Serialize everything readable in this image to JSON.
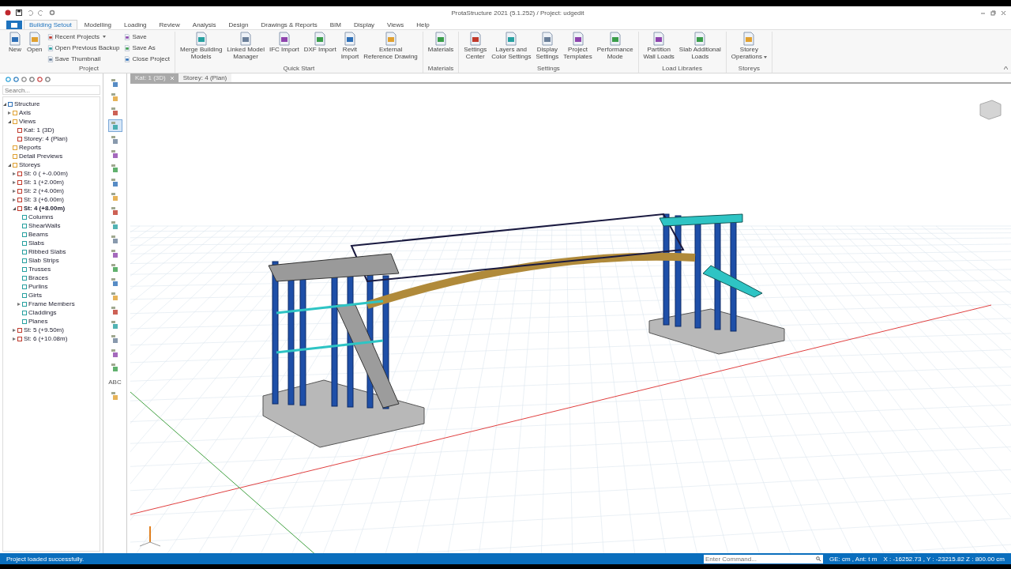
{
  "title_bar": {
    "title": "ProtaStructure 2021 (5.1.252) / Project: udgedit"
  },
  "menu_tabs": [
    {
      "label": "Building Setout",
      "selected": true
    },
    {
      "label": "Modelling",
      "selected": false
    },
    {
      "label": "Loading",
      "selected": false
    },
    {
      "label": "Review",
      "selected": false
    },
    {
      "label": "Analysis",
      "selected": false
    },
    {
      "label": "Design",
      "selected": false
    },
    {
      "label": "Drawings & Reports",
      "selected": false
    },
    {
      "label": "BIM",
      "selected": false
    },
    {
      "label": "Display",
      "selected": false
    },
    {
      "label": "Views",
      "selected": false
    },
    {
      "label": "Help",
      "selected": false
    }
  ],
  "ribbon_groups": [
    {
      "label": "Project",
      "buttons": [
        {
          "label": "New",
          "kind": "large"
        },
        {
          "label": "Open",
          "kind": "large"
        },
        {
          "label": "Recent Projects",
          "kind": "small",
          "dropdown": true
        },
        {
          "label": "Open Previous Backup",
          "kind": "small"
        },
        {
          "label": "Save Thumbnail",
          "kind": "small"
        },
        {
          "label": "Save",
          "kind": "small"
        },
        {
          "label": "Save As",
          "kind": "small"
        },
        {
          "label": "Close Project",
          "kind": "small"
        }
      ]
    },
    {
      "label": "Quick Start",
      "buttons": [
        {
          "label": "Merge Building\nModels",
          "kind": "large"
        },
        {
          "label": "Linked Model\nManager",
          "kind": "large"
        },
        {
          "label": "IFC Import",
          "kind": "large"
        },
        {
          "label": "DXF Import",
          "kind": "large"
        },
        {
          "label": "Revit\nImport",
          "kind": "large"
        },
        {
          "label": "External\nReference Drawing",
          "kind": "large"
        }
      ]
    },
    {
      "label": "Materials",
      "buttons": [
        {
          "label": "Materials",
          "kind": "large"
        }
      ]
    },
    {
      "label": "Settings",
      "buttons": [
        {
          "label": "Settings\nCenter",
          "kind": "large"
        },
        {
          "label": "Layers and\nColor Settings",
          "kind": "large"
        },
        {
          "label": "Display\nSettings",
          "kind": "large"
        },
        {
          "label": "Project\nTemplates",
          "kind": "large"
        },
        {
          "label": "Performance\nMode",
          "kind": "large"
        }
      ]
    },
    {
      "label": "Load Libraries",
      "buttons": [
        {
          "label": "Partition\nWall Loads",
          "kind": "large"
        },
        {
          "label": "Slab Additional\nLoads",
          "kind": "large"
        }
      ]
    },
    {
      "label": "Storeys",
      "buttons": [
        {
          "label": "Storey\nOperations",
          "kind": "large",
          "dropdown": true
        }
      ]
    }
  ],
  "explorer": {
    "search": {
      "placeholder": "Search..."
    },
    "tree": [
      {
        "label": "Structure",
        "expanded": true,
        "children": [
          {
            "label": "Axis",
            "expanded": false
          },
          {
            "label": "Views",
            "expanded": true,
            "children": [
              {
                "label": "Kat: 1 (3D)"
              },
              {
                "label": "Storey: 4 (Plan)"
              }
            ]
          },
          {
            "label": "Reports"
          },
          {
            "label": "Detail Previews"
          },
          {
            "label": "Storeys",
            "expanded": true,
            "children": [
              {
                "label": "St: 0 ( +-0.00m)",
                "expanded": false
              },
              {
                "label": "St: 1 (+2.00m)",
                "expanded": false
              },
              {
                "label": "St: 2 (+4.00m)",
                "expanded": false
              },
              {
                "label": "St: 3 (+6.00m)",
                "expanded": false
              },
              {
                "label": "St: 4 (+8.00m)",
                "expanded": true,
                "active": true,
                "children": [
                  {
                    "label": "Columns"
                  },
                  {
                    "label": "ShearWalls"
                  },
                  {
                    "label": "Beams"
                  },
                  {
                    "label": "Slabs"
                  },
                  {
                    "label": "Ribbed Slabs"
                  },
                  {
                    "label": "Slab Strips"
                  },
                  {
                    "label": "Trusses"
                  },
                  {
                    "label": "Braces"
                  },
                  {
                    "label": "Purlins"
                  },
                  {
                    "label": "Girts"
                  },
                  {
                    "label": "Frame Members",
                    "expanded": false
                  },
                  {
                    "label": "Claddings"
                  },
                  {
                    "label": "Planes"
                  }
                ]
              },
              {
                "label": "St: 5 (+9.50m)",
                "expanded": false
              },
              {
                "label": "St: 6 (+10.08m)",
                "expanded": false
              }
            ]
          }
        ]
      }
    ]
  },
  "tool_strip": [
    {
      "selected": false
    },
    {
      "selected": false
    },
    {
      "selected": false
    },
    {
      "selected": true
    },
    {
      "selected": false
    },
    {
      "selected": false
    },
    {
      "selected": false
    },
    {
      "selected": false
    },
    {
      "selected": false
    },
    {
      "selected": false
    },
    {
      "selected": false
    },
    {
      "selected": false
    },
    {
      "selected": false
    },
    {
      "selected": false
    },
    {
      "selected": false
    },
    {
      "selected": false
    },
    {
      "selected": false
    },
    {
      "selected": false
    },
    {
      "selected": false
    },
    {
      "selected": false
    },
    {
      "selected": false
    },
    {
      "label": "ABC",
      "selected": false
    },
    {
      "selected": false
    }
  ],
  "view_tabs": [
    {
      "label": "Kat: 1 (3D)",
      "selected": true,
      "closable": true
    },
    {
      "label": "Storey: 4 (Plan)",
      "selected": false
    }
  ],
  "status_bar": {
    "message": "Project loaded successfully.",
    "command": {
      "placeholder": "Enter Command..."
    },
    "units": "GE: cm , Ant: t m",
    "coordinates": "X : -16252.73 , Y : -23215.82   Z : 800.00 cm"
  }
}
